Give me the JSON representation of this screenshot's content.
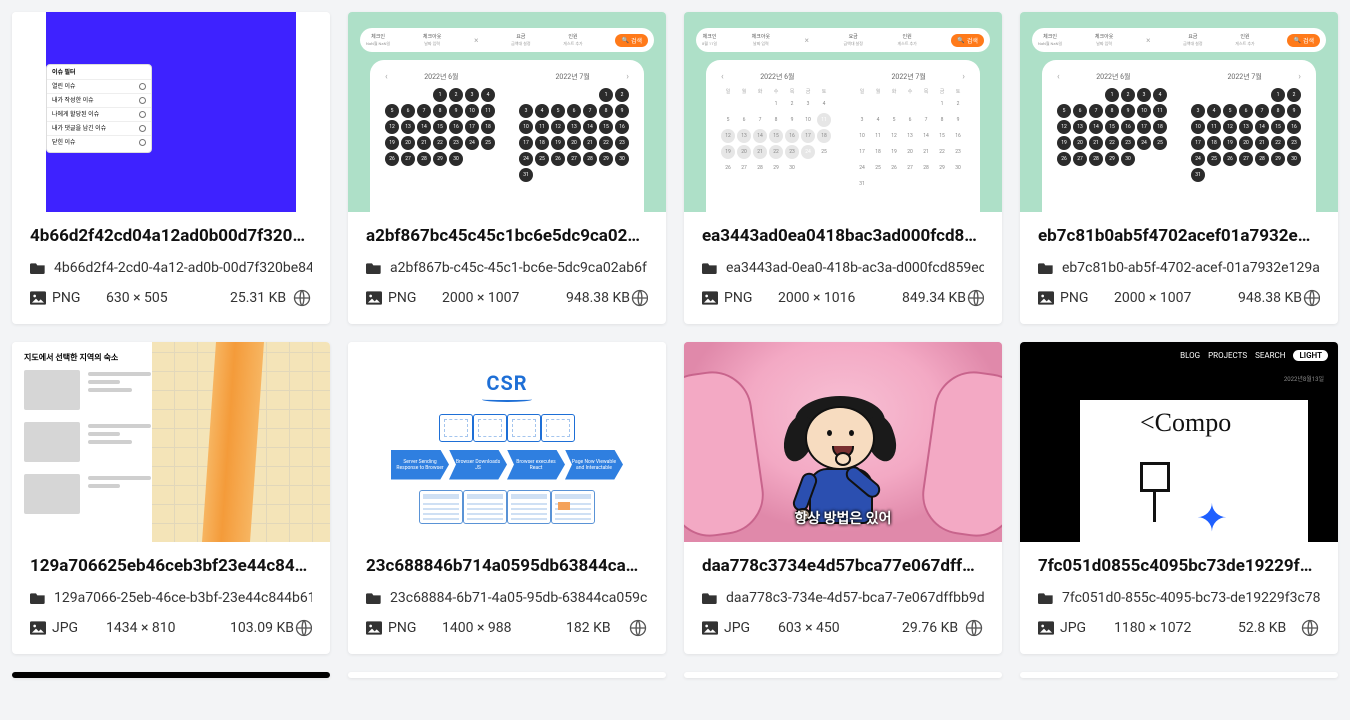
{
  "thumbs": {
    "t1": {
      "popup_title": "이슈 필터",
      "popup_items": [
        "열린 이슈",
        "내가 작성한 이슈",
        "나에게 할당된 이슈",
        "내가 댓글을 남긴 이슈",
        "닫힌 이슈"
      ]
    },
    "tcal": {
      "bar_items": [
        {
          "label": "체크인",
          "sub": "NaN월 NaN일"
        },
        {
          "label": "체크아웃",
          "sub": "날짜 입력"
        },
        {
          "label": "요금",
          "sub": "금액대 설정"
        },
        {
          "label": "인원",
          "sub": "게스트 추가"
        }
      ],
      "bar_items_alt_sub0": "8월 11일",
      "search_label": "검색",
      "month_left": "2022년 6월",
      "month_right": "2022년 7월",
      "dows": [
        "일",
        "월",
        "화",
        "수",
        "목",
        "금",
        "토"
      ]
    },
    "t5": {
      "title": "지도에서 선택한 지역의 숙소"
    },
    "t6": {
      "title": "CSR",
      "steps": [
        "Server Sending Response to Browser",
        "Browser Downloads JS",
        "Browser executes React",
        "Page Now Viewable and Interactable"
      ]
    },
    "t7": {
      "caption": "항상 방법은 있어"
    },
    "t8": {
      "nav": [
        "BLOG",
        "PROJECTS",
        "SEARCH"
      ],
      "nav_pill": "LIGHT",
      "date": "2022년8월13일",
      "sketch_text": "<Compo"
    }
  },
  "cards": [
    {
      "title": "4b66d2f42cd04a12ad0b00d7f320…",
      "folder": "4b66d2f4-2cd0-4a12-ad0b-00d7f320be84",
      "format": "PNG",
      "dimensions": "630 × 505",
      "size": "25.31 KB"
    },
    {
      "title": "a2bf867bc45c45c1bc6e5dc9ca02…",
      "folder": "a2bf867b-c45c-45c1-bc6e-5dc9ca02ab6f",
      "format": "PNG",
      "dimensions": "2000 × 1007",
      "size": "948.38 KB"
    },
    {
      "title": "ea3443ad0ea0418bac3ad000fcd8…",
      "folder": "ea3443ad-0ea0-418b-ac3a-d000fcd859ec",
      "format": "PNG",
      "dimensions": "2000 × 1016",
      "size": "849.34 KB"
    },
    {
      "title": "eb7c81b0ab5f4702acef01a7932e1…",
      "folder": "eb7c81b0-ab5f-4702-acef-01a7932e129a",
      "format": "PNG",
      "dimensions": "2000 × 1007",
      "size": "948.38 KB"
    },
    {
      "title": "129a706625eb46ceb3bf23e44c84…",
      "folder": "129a7066-25eb-46ce-b3bf-23e44c844b61",
      "format": "JPG",
      "dimensions": "1434 × 810",
      "size": "103.09 KB"
    },
    {
      "title": "23c688846b714a0595db63844ca…",
      "folder": "23c68884-6b71-4a05-95db-63844ca059c",
      "format": "PNG",
      "dimensions": "1400 × 988",
      "size": "182 KB"
    },
    {
      "title": "daa778c3734e4d57bca77e067dffb…",
      "folder": "daa778c3-734e-4d57-bca7-7e067dffbb9d",
      "format": "JPG",
      "dimensions": "603 × 450",
      "size": "29.76 KB"
    },
    {
      "title": "7fc051d0855c4095bc73de19229f3…",
      "folder": "7fc051d0-855c-4095-bc73-de19229f3c78",
      "format": "JPG",
      "dimensions": "1180 × 1072",
      "size": "52.8 KB"
    }
  ]
}
